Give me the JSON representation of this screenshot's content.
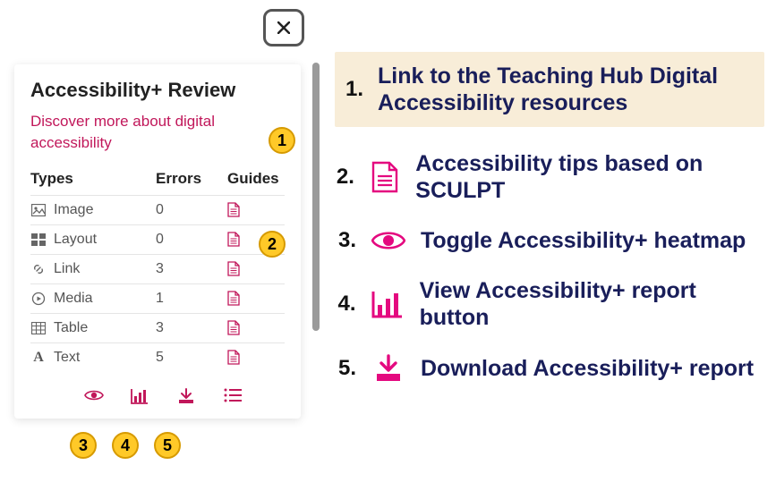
{
  "panel": {
    "title": "Accessibility+ Review",
    "discover_link": "Discover more about digital accessibility",
    "headers": {
      "types": "Types",
      "errors": "Errors",
      "guides": "Guides"
    },
    "rows": [
      {
        "icon": "image",
        "label": "Image",
        "errors": "0"
      },
      {
        "icon": "layout",
        "label": "Layout",
        "errors": "0"
      },
      {
        "icon": "link",
        "label": "Link",
        "errors": "3"
      },
      {
        "icon": "media",
        "label": "Media",
        "errors": "1"
      },
      {
        "icon": "table",
        "label": "Table",
        "errors": "3"
      },
      {
        "icon": "text",
        "label": "Text",
        "errors": "5"
      }
    ]
  },
  "badges": {
    "b1": "1",
    "b2": "2",
    "b3": "3",
    "b4": "4",
    "b5": "5"
  },
  "legend": {
    "items": [
      {
        "num": "1.",
        "text": "Link to the Teaching Hub Digital Accessibility resources"
      },
      {
        "num": "2.",
        "text": "Accessibility tips based on SCULPT"
      },
      {
        "num": "3.",
        "text": "Toggle Accessibility+ heatmap"
      },
      {
        "num": "4.",
        "text": "View Accessibility+ report button"
      },
      {
        "num": "5.",
        "text": "Download Accessibility+ report"
      }
    ]
  }
}
